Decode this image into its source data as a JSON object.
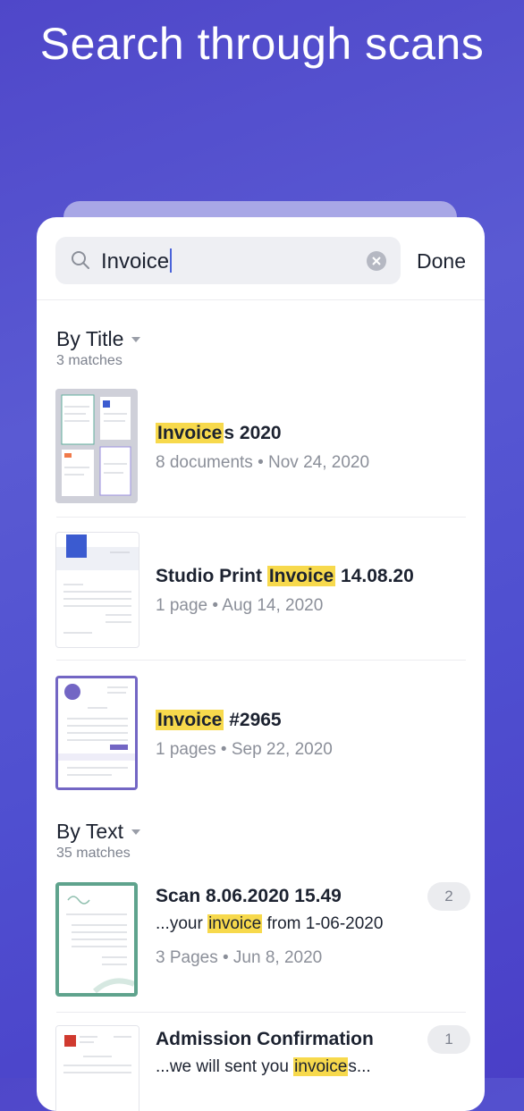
{
  "headline": "Search through scans",
  "search": {
    "query": "Invoice",
    "done_label": "Done"
  },
  "sections": {
    "by_title": {
      "title": "By Title",
      "count": "3 matches",
      "items": [
        {
          "title_hl": "Invoice",
          "title_rest": "s 2020",
          "meta": "8 documents • Nov 24, 2020"
        },
        {
          "title_pre": "Studio Print ",
          "title_hl": "Invoice",
          "title_rest": " 14.08.20",
          "meta": "1 page • Aug 14, 2020"
        },
        {
          "title_hl": "Invoice",
          "title_rest": " #2965",
          "meta": "1 pages • Sep 22, 2020"
        }
      ]
    },
    "by_text": {
      "title": "By Text",
      "count": "35 matches",
      "items": [
        {
          "title": "Scan 8.06.2020 15.49",
          "snip_pre": "...your ",
          "snip_hl": "invoice",
          "snip_rest": " from 1-06-2020",
          "meta": "3 Pages • Jun 8, 2020",
          "badge": "2"
        },
        {
          "title": "Admission Confirmation",
          "snip_pre": "...we will sent you ",
          "snip_hl": "invoice",
          "snip_rest": "s...",
          "badge": "1"
        }
      ]
    }
  },
  "colors": {
    "background": "#4f4fd0",
    "highlight": "#f7d94c",
    "accent": "#4a63d9"
  },
  "icons": {
    "search": "search-icon",
    "clear": "clear-icon",
    "dropdown": "triangle-down-icon"
  }
}
